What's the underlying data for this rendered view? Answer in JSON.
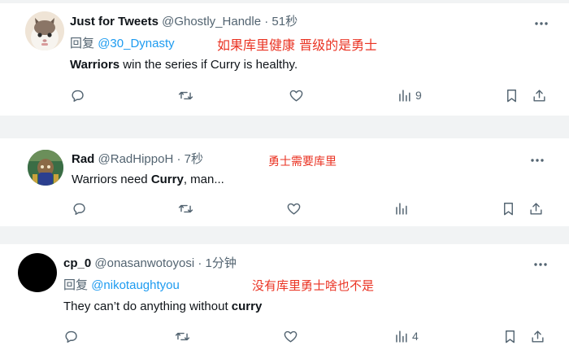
{
  "tweets": [
    {
      "display_name": "Just for Tweets",
      "handle": "@Ghostly_Handle",
      "time": "51秒",
      "reply_label": "回复",
      "reply_to": "@30_Dynasty",
      "text_parts": [
        "Warriors",
        " win the series if Curry is healthy."
      ],
      "annotation": "如果库里健康 晋级的是勇士",
      "views": "9"
    },
    {
      "display_name": "Rad",
      "handle": "@RadHippoH",
      "time": "7秒",
      "text_parts": [
        "Warriors need ",
        "Curry",
        ", man..."
      ],
      "annotation": "勇士需要库里",
      "views": ""
    },
    {
      "display_name": "cp_0",
      "handle": "@onasanwotoyosi",
      "time": "1分钟",
      "reply_label": "回复",
      "reply_to": "@nikotaughtyou",
      "text_parts": [
        "They can’t do anything without ",
        "curry"
      ],
      "annotation": "没有库里勇士啥也不是",
      "views": "4"
    }
  ],
  "separator": " · ",
  "icons": {
    "more": "more-horizontal-icon",
    "reply": "reply-bubble-icon",
    "retweet": "retweet-icon",
    "like": "heart-icon",
    "views": "views-bar-chart-icon",
    "bookmark": "bookmark-icon",
    "share": "share-upload-icon"
  },
  "colors": {
    "link": "#1d9bf0",
    "annotation": "#ea3323",
    "secondary_text": "#536471",
    "primary_text": "#0f1419",
    "separator": "#f1f3f4"
  }
}
